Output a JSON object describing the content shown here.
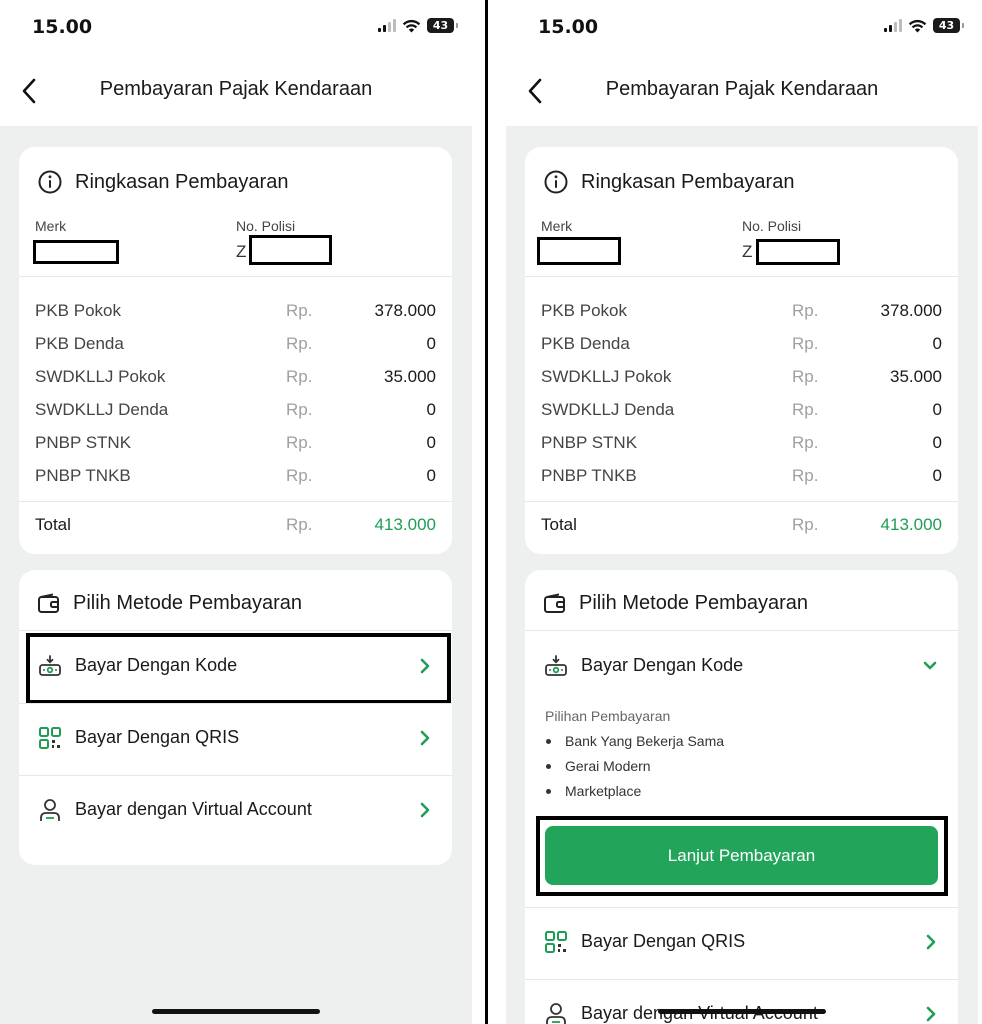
{
  "status": {
    "time": "15.00",
    "battery": "43"
  },
  "header": {
    "title": "Pembayaran Pajak Kendaraan"
  },
  "summary": {
    "heading": "Ringkasan Pembayaran",
    "merk_label": "Merk",
    "nopol_label": "No. Polisi",
    "nopol_prefix": "Z",
    "currency": "Rp.",
    "items": [
      {
        "label": "PKB Pokok",
        "value": "378.000"
      },
      {
        "label": "PKB Denda",
        "value": "0"
      },
      {
        "label": "SWDKLLJ Pokok",
        "value": "35.000"
      },
      {
        "label": "SWDKLLJ Denda",
        "value": "0"
      },
      {
        "label": "PNBP STNK",
        "value": "0"
      },
      {
        "label": "PNBP TNKB",
        "value": "0"
      }
    ],
    "total_label": "Total",
    "total_value": "413.000"
  },
  "methods": {
    "heading": "Pilih Metode Pembayaran",
    "items": [
      {
        "label": "Bayar Dengan Kode",
        "icon": "cash-register-icon"
      },
      {
        "label": "Bayar Dengan QRIS",
        "icon": "qr-code-icon"
      },
      {
        "label": "Bayar dengan Virtual Account",
        "icon": "user-icon"
      }
    ],
    "expanded": {
      "sub_heading": "Pilihan Pembayaran",
      "options": [
        "Bank Yang Bekerja Sama",
        "Gerai Modern",
        "Marketplace"
      ],
      "button_label": "Lanjut Pembayaran"
    }
  },
  "colors": {
    "accent": "#22a55a",
    "total": "#1f9d55",
    "background": "#eef0f0"
  }
}
